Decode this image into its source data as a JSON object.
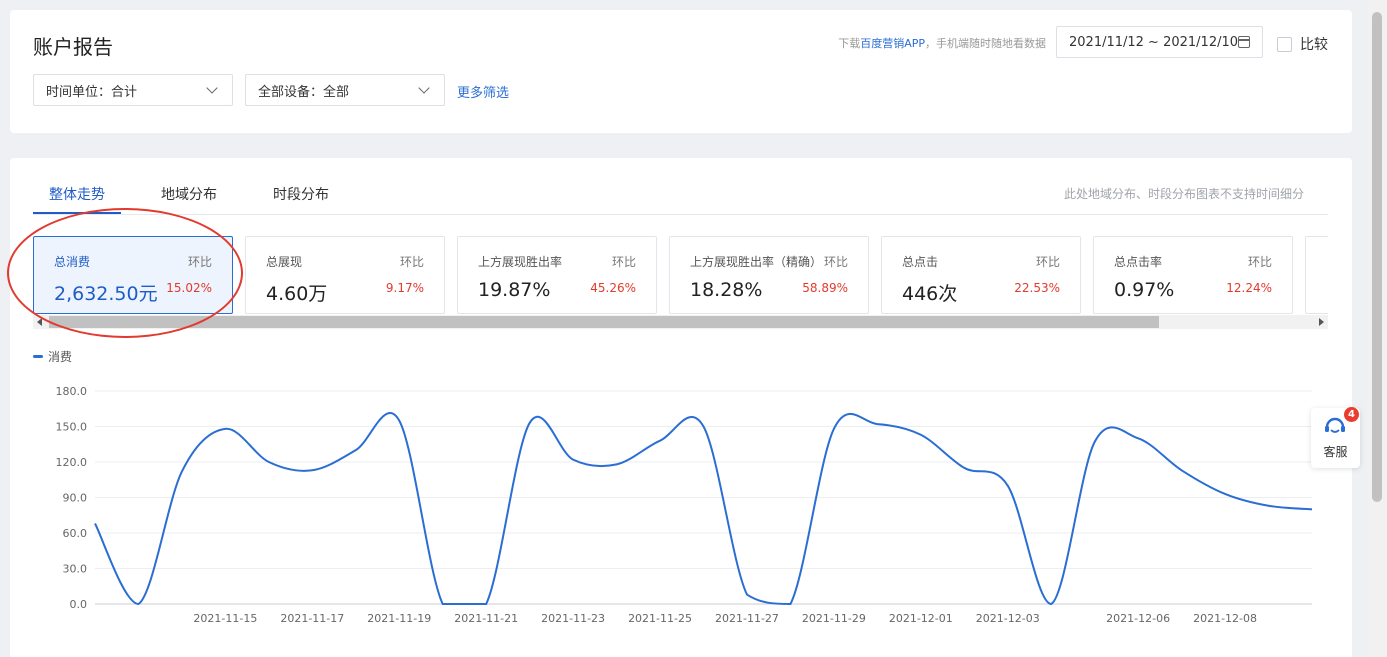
{
  "header": {
    "title": "账户报告",
    "download_prefix": "下载",
    "download_app": "百度营销APP",
    "download_suffix": "，手机端随时随地看数据",
    "date_range": "2021/11/12 ~ 2021/12/10",
    "compare_label": "比较"
  },
  "filters": {
    "time_unit": "时间单位：合计",
    "device": "全部设备：全部",
    "more": "更多筛选"
  },
  "tabs": [
    {
      "label": "整体走势",
      "active": true
    },
    {
      "label": "地域分布",
      "active": false
    },
    {
      "label": "时段分布",
      "active": false
    }
  ],
  "tab_note": "此处地域分布、时段分布图表不支持时间细分",
  "metrics": [
    {
      "name": "总消费",
      "ratio_label": "环比",
      "value": "2,632.50元",
      "ratio": "15.02%",
      "active": true
    },
    {
      "name": "总展现",
      "ratio_label": "环比",
      "value": "4.60万",
      "ratio": "9.17%"
    },
    {
      "name": "上方展现胜出率",
      "ratio_label": "环比",
      "value": "19.87%",
      "ratio": "45.26%"
    },
    {
      "name": "上方展现胜出率（精确）",
      "ratio_label": "环比",
      "value": "18.28%",
      "ratio": "58.89%"
    },
    {
      "name": "总点击",
      "ratio_label": "环比",
      "value": "446次",
      "ratio": "22.53%"
    },
    {
      "name": "总点击率",
      "ratio_label": "环比",
      "value": "0.97%",
      "ratio": "12.24%"
    }
  ],
  "legend_label": "消费",
  "service": {
    "label": "客服",
    "badge": "4"
  },
  "colors": {
    "accent": "#1f5cc7",
    "line": "#2a6ed4",
    "increase": "#e33a2d",
    "annotation": "#e23a2e"
  },
  "chart_data": {
    "type": "line",
    "x": [
      "2021-11-12",
      "2021-11-13",
      "2021-11-14",
      "2021-11-15",
      "2021-11-16",
      "2021-11-17",
      "2021-11-18",
      "2021-11-19",
      "2021-11-20",
      "2021-11-21",
      "2021-11-22",
      "2021-11-23",
      "2021-11-24",
      "2021-11-25",
      "2021-11-26",
      "2021-11-27",
      "2021-11-28",
      "2021-11-29",
      "2021-11-30",
      "2021-12-01",
      "2021-12-02",
      "2021-12-03",
      "2021-12-04",
      "2021-12-05",
      "2021-12-06",
      "2021-12-07",
      "2021-12-08",
      "2021-12-09",
      "2021-12-10"
    ],
    "series": [
      {
        "name": "消费",
        "values": [
          68,
          0,
          112,
          148,
          120,
          113,
          130,
          155,
          0,
          0,
          153,
          122,
          118,
          138,
          150,
          8,
          0,
          148,
          152,
          143,
          115,
          100,
          0,
          137,
          140,
          113,
          93,
          83,
          80
        ]
      }
    ],
    "xticks": [
      "2021-11-15",
      "2021-11-17",
      "2021-11-19",
      "2021-11-21",
      "2021-11-23",
      "2021-11-25",
      "2021-11-27",
      "2021-11-29",
      "2021-12-01",
      "2021-12-03",
      "2021-12-06",
      "2021-12-08"
    ],
    "yticks": [
      "0.0",
      "30.0",
      "60.0",
      "90.0",
      "120.0",
      "150.0",
      "180.0"
    ],
    "ylim": [
      0,
      180
    ],
    "grid": true,
    "legend": "top-left"
  }
}
